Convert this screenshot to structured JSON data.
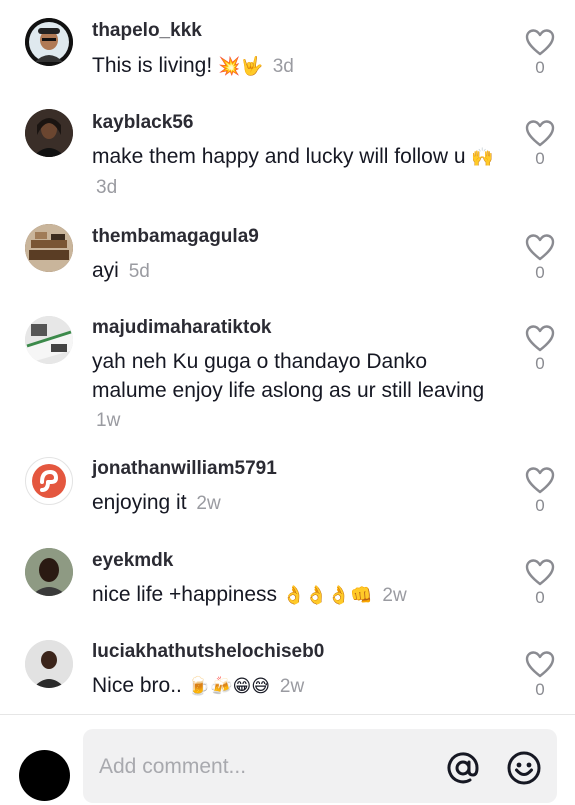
{
  "comments": [
    {
      "username": "thapelo_kkk",
      "text": "This is living!",
      "emoji": "💥🤟",
      "time": "3d",
      "likes": "0"
    },
    {
      "username": "kayblack56",
      "text": "make them happy and lucky will follow u",
      "emoji": "🙌",
      "time": "3d",
      "likes": "0"
    },
    {
      "username": "thembamagagula9",
      "text": "ayi",
      "emoji": "",
      "time": "5d",
      "likes": "0"
    },
    {
      "username": "majudimaharatiktok",
      "text": "yah neh Ku guga o thandayo Danko malume enjoy life aslong as ur still leaving",
      "emoji": "",
      "time": "1w",
      "likes": "0"
    },
    {
      "username": "jonathanwilliam5791",
      "text": "enjoying it",
      "emoji": "",
      "time": "2w",
      "likes": "0"
    },
    {
      "username": "eyekmdk",
      "text": "nice life +happiness",
      "emoji": "👌👌👌👊",
      "time": "2w",
      "likes": "0"
    },
    {
      "username": "luciakhathutshelochiseb0",
      "text": "Nice bro..",
      "emoji": "🍺🍻😁😅",
      "time": "2w",
      "likes": "0"
    }
  ],
  "composer": {
    "placeholder": "Add comment...",
    "mention_icon": "at-sign-icon",
    "emoji_icon": "smiley-face-icon"
  },
  "colors": {
    "accent": "#161823",
    "muted": "#9a9ba1",
    "input_bg": "#f1f1f2"
  }
}
